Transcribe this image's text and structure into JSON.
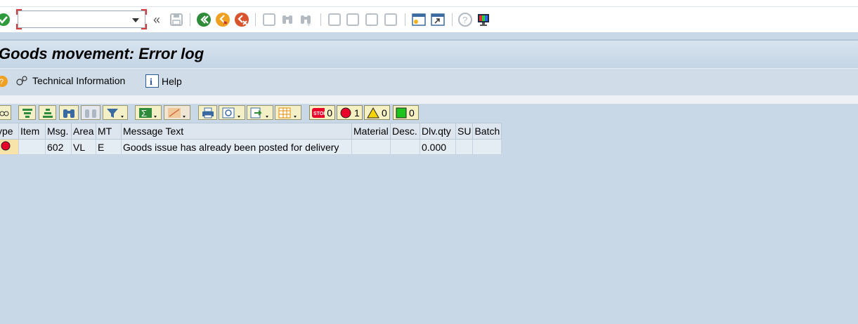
{
  "toolbar": {
    "command_field": "",
    "icons": [
      "enter-icon",
      "collapse-icon",
      "save-icon",
      "back-icon",
      "exit-icon",
      "cancel-icon",
      "print-icon",
      "find-icon",
      "find-next-icon",
      "first-page-icon",
      "previous-page-icon",
      "next-page-icon",
      "last-page-icon",
      "create-session-icon",
      "shortcut-icon",
      "help-icon",
      "customize-layout-icon"
    ],
    "collapse_glyph": "«"
  },
  "title": "Goods movement: Error log",
  "app_toolbar": {
    "technical_info_label": "Technical Information",
    "help_label": "Help"
  },
  "status_counters": {
    "stop": "0",
    "error": "1",
    "warning": "0",
    "success": "0"
  },
  "table": {
    "columns": [
      "ype",
      "Item",
      "Msg.",
      "Area",
      "MT",
      "Message Text",
      "Material",
      "Desc.",
      "Dlv.qty",
      "SU",
      "Batch"
    ],
    "rows": [
      {
        "type": "error",
        "item": "",
        "msg": "602",
        "area": "VL",
        "mt": "E",
        "text": "Goods issue has already been posted for delivery",
        "material": "",
        "desc": "",
        "qty": "0.000",
        "su": "",
        "batch": ""
      }
    ]
  },
  "colors": {
    "error": "#e8002a",
    "warning": "#f5d400",
    "success": "#1ec31e",
    "accent": "#e88a00"
  }
}
